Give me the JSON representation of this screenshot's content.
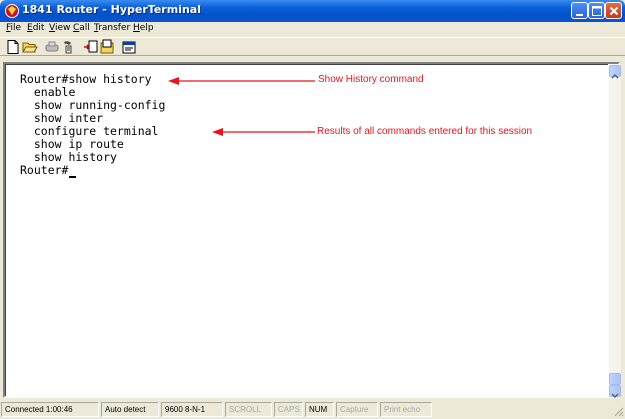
{
  "window": {
    "title": "1841 Router - HyperTerminal",
    "colors": {
      "titlebar": "#0a5fd8",
      "annotation": "#e8141e"
    }
  },
  "menu": {
    "items": [
      {
        "key": "F",
        "rest": "ile"
      },
      {
        "key": "E",
        "rest": "dit"
      },
      {
        "key": "V",
        "rest": "iew"
      },
      {
        "key": "C",
        "rest": "all"
      },
      {
        "key": "T",
        "rest": "ransfer"
      },
      {
        "key": "H",
        "rest": "elp"
      }
    ]
  },
  "toolbar": {
    "icons": [
      "new-connection-icon",
      "open-folder-icon",
      "connect-icon",
      "disconnect-icon",
      "send-icon",
      "receive-icon",
      "properties-icon"
    ]
  },
  "terminal": {
    "lines": [
      "Router#show history",
      "  enable",
      "  show running-config",
      "  show inter",
      "  configure terminal",
      "  show ip route",
      "  show history",
      "Router#"
    ]
  },
  "annotations": {
    "history_command": "Show History command",
    "results": "Results of all commands entered for this session"
  },
  "status": {
    "connected": "Connected 1:00:46",
    "detect": "Auto detect",
    "settings": "9600 8-N-1",
    "scroll": "SCROLL",
    "caps": "CAPS",
    "num": "NUM",
    "capture": "Capture",
    "print_echo": "Print echo"
  }
}
